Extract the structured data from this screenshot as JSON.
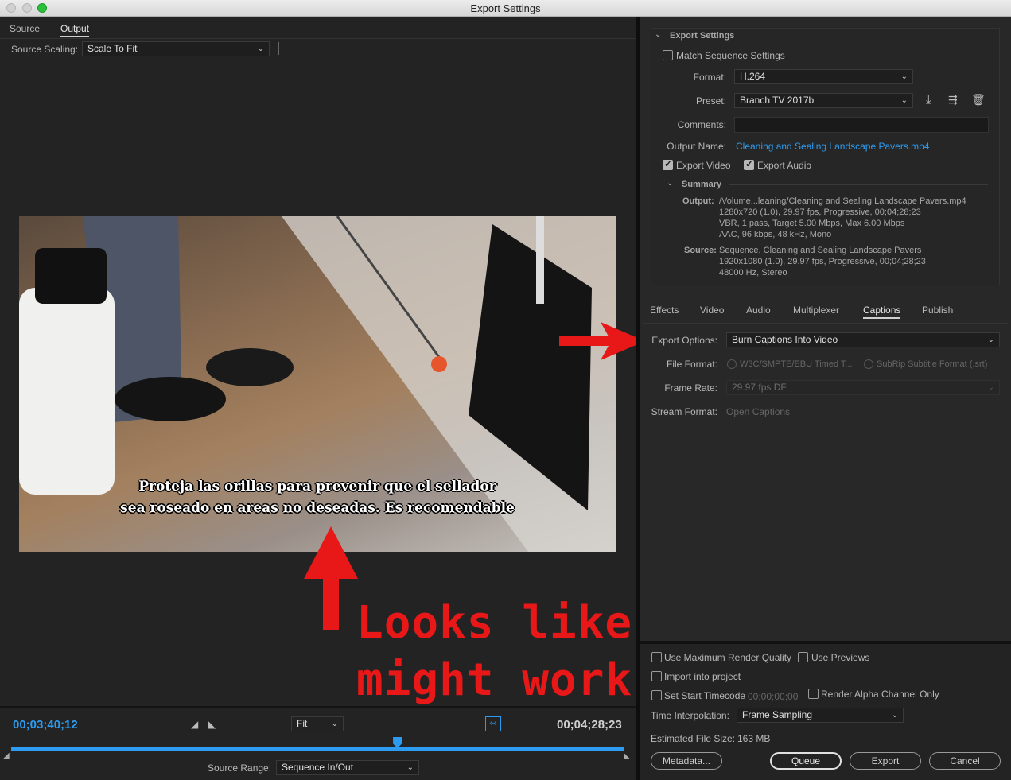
{
  "window": {
    "title": "Export Settings"
  },
  "left_panel": {
    "tabs": [
      "Source",
      "Output"
    ],
    "source_scaling_label": "Source Scaling:",
    "source_scaling_value": "Scale To Fit",
    "captions": [
      "Proteja las orillas para prevenir que el sellador",
      "sea roseado en areas no deseadas. Es recomendable"
    ],
    "annotation_line1": "Looks like it just",
    "annotation_line2": "might work!",
    "current_time": "00;03;40;12",
    "zoom_value": "Fit",
    "duration": "00;04;28;23",
    "source_range_label": "Source Range:",
    "source_range_value": "Sequence In/Out",
    "playhead_progress": 0.6
  },
  "export_settings": {
    "header": "Export Settings",
    "match_sequence_label": "Match Sequence Settings",
    "format_label": "Format:",
    "format_value": "H.264",
    "preset_label": "Preset:",
    "preset_value": "Branch TV 2017b",
    "comments_label": "Comments:",
    "comments_value": "",
    "output_name_label": "Output Name:",
    "output_name_value": "Cleaning and Sealing Landscape Pavers.mp4",
    "export_video_label": "Export Video",
    "export_audio_label": "Export Audio",
    "summary_header": "Summary",
    "output_label": "Output:",
    "output_lines": [
      "/Volume...leaning/Cleaning and Sealing Landscape Pavers.mp4",
      "1280x720 (1.0), 29.97 fps, Progressive, 00;04;28;23",
      "VBR, 1 pass, Target 5.00 Mbps, Max 6.00 Mbps",
      "AAC, 96 kbps, 48 kHz, Mono"
    ],
    "source_label": "Source:",
    "source_lines": [
      "Sequence, Cleaning and Sealing Landscape Pavers",
      "1920x1080 (1.0), 29.97 fps, Progressive, 00;04;28;23",
      "48000 Hz, Stereo"
    ]
  },
  "settings_tabs": [
    "Effects",
    "Video",
    "Audio",
    "Multiplexer",
    "Captions",
    "Publish"
  ],
  "captions_panel": {
    "export_options_label": "Export Options:",
    "export_options_value": "Burn Captions Into Video",
    "file_format_label": "File Format:",
    "file_format_opt1": "W3C/SMPTE/EBU Timed T...",
    "file_format_opt2": "SubRip Subtitle Format (.srt)",
    "frame_rate_label": "Frame Rate:",
    "frame_rate_value": "29.97 fps DF",
    "stream_format_label": "Stream Format:",
    "stream_format_value": "Open Captions"
  },
  "bottom": {
    "max_render_label": "Use Maximum Render Quality",
    "use_previews_label": "Use Previews",
    "import_label": "Import into project",
    "start_tc_label": "Set Start Timecode",
    "start_tc_value": "00;00;00;00",
    "alpha_label": "Render Alpha Channel Only",
    "time_interp_label": "Time Interpolation:",
    "time_interp_value": "Frame Sampling",
    "file_size_label": "Estimated File Size:",
    "file_size_value": "163 MB",
    "metadata_btn": "Metadata...",
    "queue_btn": "Queue",
    "export_btn": "Export",
    "cancel_btn": "Cancel"
  },
  "colors": {
    "accent": "#2d9cf0",
    "annotation": "#e81818",
    "panel": "#232323"
  }
}
